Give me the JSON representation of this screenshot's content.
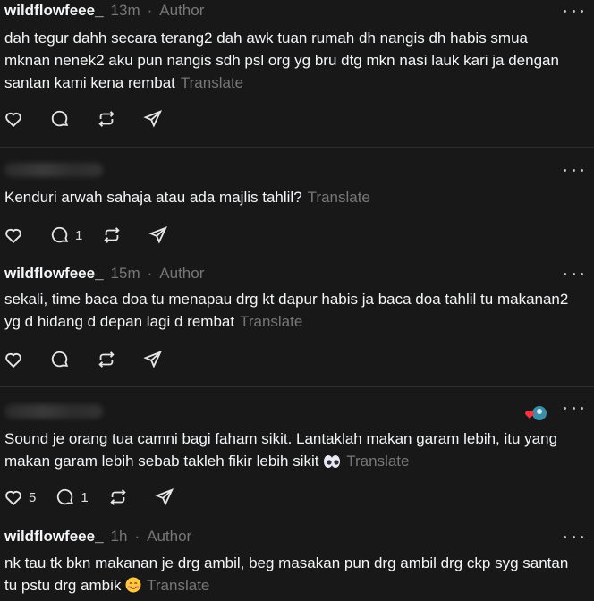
{
  "translate_label": "Translate",
  "posts": [
    {
      "username": "wildflowfeee_",
      "time": "13m",
      "author_tag": "Author",
      "text": "dah tegur dahh secara terang2 dah awk tuan rumah dh nangis dh habis smua mknan nenek2 aku pun nangis sdh psl org yg bru dtg mkn nasi lauk kari ja dengan santan kami kena rembat",
      "likes": "",
      "replies": ""
    },
    {
      "username": "",
      "time": "",
      "author_tag": "",
      "text": "Kenduri arwah sahaja atau ada majlis tahlil?",
      "likes": "",
      "replies": "1"
    },
    {
      "username": "wildflowfeee_",
      "time": "15m",
      "author_tag": "Author",
      "text": "sekali, time baca doa tu menapau drg kt dapur habis ja baca doa tahlil tu makanan2 yg d hidang d depan lagi d rembat",
      "likes": "",
      "replies": ""
    },
    {
      "username": "",
      "time": "",
      "author_tag": "",
      "text": "Sound je orang tua camni bagi faham sikit. Lantaklah makan garam lebih, itu yang makan garam lebih sebab takleh fikir lebih sikit",
      "likes": "5",
      "replies": "1"
    },
    {
      "username": "wildflowfeee_",
      "time": "1h",
      "author_tag": "Author",
      "text": "nk tau tk bkn makanan je drg ambil, beg masakan pun drg ambil drg ckp syg santan tu pstu drg ambik",
      "likes": "",
      "replies": ""
    }
  ]
}
